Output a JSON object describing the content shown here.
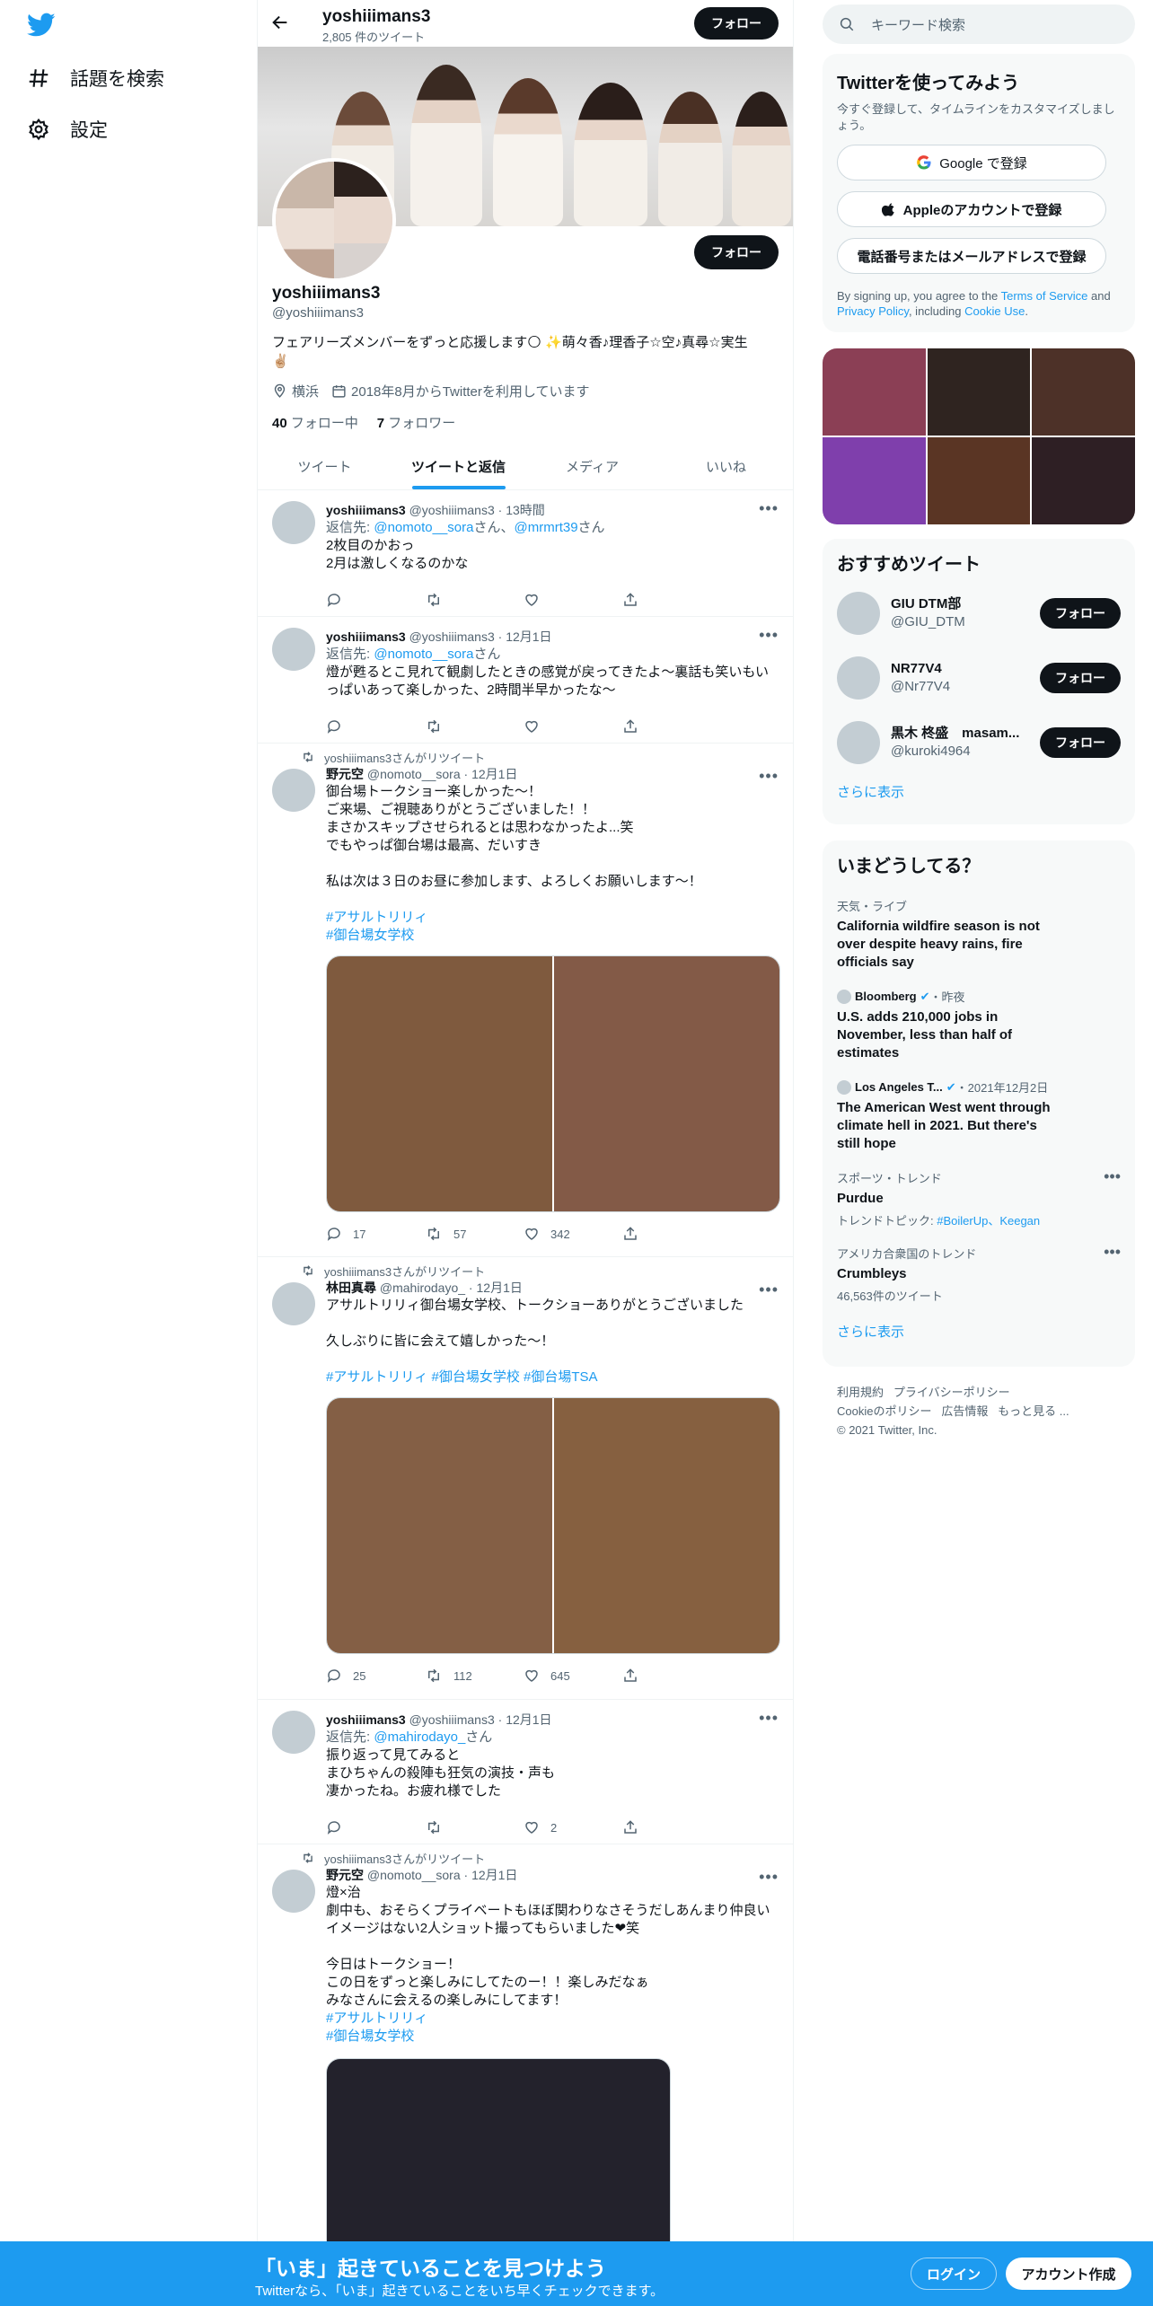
{
  "nav": {
    "explore": "話題を検索",
    "settings": "設定"
  },
  "header": {
    "name": "yoshiiimans3",
    "tweet_count": "2,805 件のツイート",
    "follow": "フォロー"
  },
  "profile": {
    "name": "yoshiiimans3",
    "handle": "@yoshiiimans3",
    "bio_line1": "フェアリーズメンバーをずっと応援します🌕 ✨萌々香♪理香子☆空♪真尋☆実生",
    "bio_line2": "✌🏼",
    "location": "横浜",
    "joined": "2018年8月からTwitterを利用しています",
    "following_count": "40",
    "following_label": "フォロー中",
    "followers_count": "7",
    "followers_label": "フォロワー",
    "follow": "フォロー"
  },
  "tabs": [
    "ツイート",
    "ツイートと返信",
    "メディア",
    "いいね"
  ],
  "tweets": [
    {
      "name": "yoshiiimans3",
      "handle": "@yoshiiimans3",
      "time": "13時間",
      "reply_prefix": "返信先: ",
      "reply_to": "@nomoto__sora",
      "reply_mid": "さん、",
      "reply_to2": "@mrmrt39",
      "reply_suffix": "さん",
      "text": "2枚目のかおっ\n2月は激しくなるのかな"
    },
    {
      "name": "yoshiiimans3",
      "handle": "@yoshiiimans3",
      "time": "12月1日",
      "reply_prefix": "返信先: ",
      "reply_to": "@nomoto__sora",
      "reply_suffix": "さん",
      "text": "燈が甦るとこ見れて観劇したときの感覚が戻ってきたよ〜裏話も笑いもいっぱいあって楽しかった、2時間半早かったな〜"
    },
    {
      "rt": "yoshiiimans3さんがリツイート",
      "name": "野元空",
      "handle": "@nomoto__sora",
      "time": "12月1日",
      "text": "御台場トークショー楽しかった〜！\nご来場、ご視聴ありがとうございました！！\nまさかスキップさせられるとは思わなかったよ...笑\nでもやっぱ御台場は最高、だいすき\n\n私は次は３日のお昼に参加します、よろしくお願いします〜！",
      "tags": [
        "#アサルトリリィ",
        "#御台場女学校"
      ],
      "replies": "17",
      "retweets": "57",
      "likes": "342"
    },
    {
      "rt": "yoshiiimans3さんがリツイート",
      "name": "林田真尋",
      "handle": "@mahirodayo_",
      "time": "12月1日",
      "text": "アサルトリリィ御台場女学校、トークショーありがとうございました\n\n久しぶりに皆に会えて嬉しかった〜！",
      "tags": [
        "#アサルトリリィ",
        "#御台場女学校",
        "#御台場TSA"
      ],
      "replies": "25",
      "retweets": "112",
      "likes": "645"
    },
    {
      "name": "yoshiiimans3",
      "handle": "@yoshiiimans3",
      "time": "12月1日",
      "reply_prefix": "返信先: ",
      "reply_to": "@mahirodayo_",
      "reply_suffix": "さん",
      "text": "振り返って見てみると\nまひちゃんの殺陣も狂気の演技・声も\n凄かったね。お疲れ様でした",
      "likes": "2"
    },
    {
      "rt": "yoshiiimans3さんがリツイート",
      "name": "野元空",
      "handle": "@nomoto__sora",
      "time": "12月1日",
      "text": "燈×治\n劇中も、おそらくプライベートもほぼ関わりなさそうだしあんまり仲良いイメージはない2人ショット撮ってもらいました❤笑\n\n今日はトークショー！\nこの日をずっと楽しみにしてたのー！！楽しみだなぁ\nみなさんに会えるの楽しみにしてます！",
      "tags": [
        "#アサルトリリィ",
        "#御台場女学校"
      ]
    }
  ],
  "search": {
    "placeholder": "キーワード検索"
  },
  "signup": {
    "title": "Twitterを使ってみよう",
    "subtitle": "今すぐ登録して、タイムラインをカスタマイズしましょう。",
    "google": "Google で登録",
    "apple": "Appleのアカウントで登録",
    "phone": "電話番号またはメールアドレスで登録",
    "legal_pre": "By signing up, you agree to the ",
    "terms": "Terms of Service",
    "legal_and": " and ",
    "privacy": "Privacy Policy",
    "legal_incl": ", including ",
    "cookie": "Cookie Use",
    "legal_end": "."
  },
  "media_colors": [
    "#8b3f55",
    "#2f2420",
    "#4d3128",
    "#7f3fac",
    "#5a3524",
    "#2e1f24"
  ],
  "who_to_follow": {
    "title": "おすすめツイート",
    "users": [
      {
        "name": "GIU DTM部",
        "handle": "@GIU_DTM"
      },
      {
        "name": "NR77V4",
        "handle": "@Nr77V4"
      },
      {
        "name": "黒木 柊盛　masam...",
        "handle": "@kuroki4964"
      }
    ],
    "follow": "フォロー",
    "show_more": "さらに表示"
  },
  "trends": {
    "title": "いまどうしてる？",
    "items": [
      {
        "meta": "天気・ライブ",
        "title": "California wildfire season is not over despite heavy rains, fire officials say"
      },
      {
        "source": "Bloomberg",
        "time": "・昨夜",
        "title": "U.S. adds 210,000 jobs in November, less than half of estimates"
      },
      {
        "source": "Los Angeles T...",
        "time": "・2021年12月2日",
        "title": "The American West went through climate hell in 2021. But there's still hope"
      },
      {
        "meta": "スポーツ・トレンド",
        "title": "Purdue",
        "topic_label": "トレンドトピック: ",
        "topics": "#BoilerUp、Keegan"
      },
      {
        "meta": "アメリカ合衆国のトレンド",
        "title": "Crumbleys",
        "count": "46,563件のツイート"
      }
    ],
    "show_more": "さらに表示"
  },
  "footer": {
    "terms": "利用規約",
    "privacy": "プライバシーポリシー",
    "cookie": "Cookieのポリシー",
    "ads": "広告情報",
    "more": "もっと見る ...",
    "copyright": "© 2021 Twitter, Inc."
  },
  "bottom": {
    "title": "「いま」起きていることを見つけよう",
    "subtitle": "Twitterなら、「いま」起きていることをいち早くチェックできます。",
    "login": "ログイン",
    "signup": "アカウント作成"
  },
  "colors": {
    "accent": "#1d9bf0",
    "text": "#0f1419",
    "muted": "#536471"
  }
}
